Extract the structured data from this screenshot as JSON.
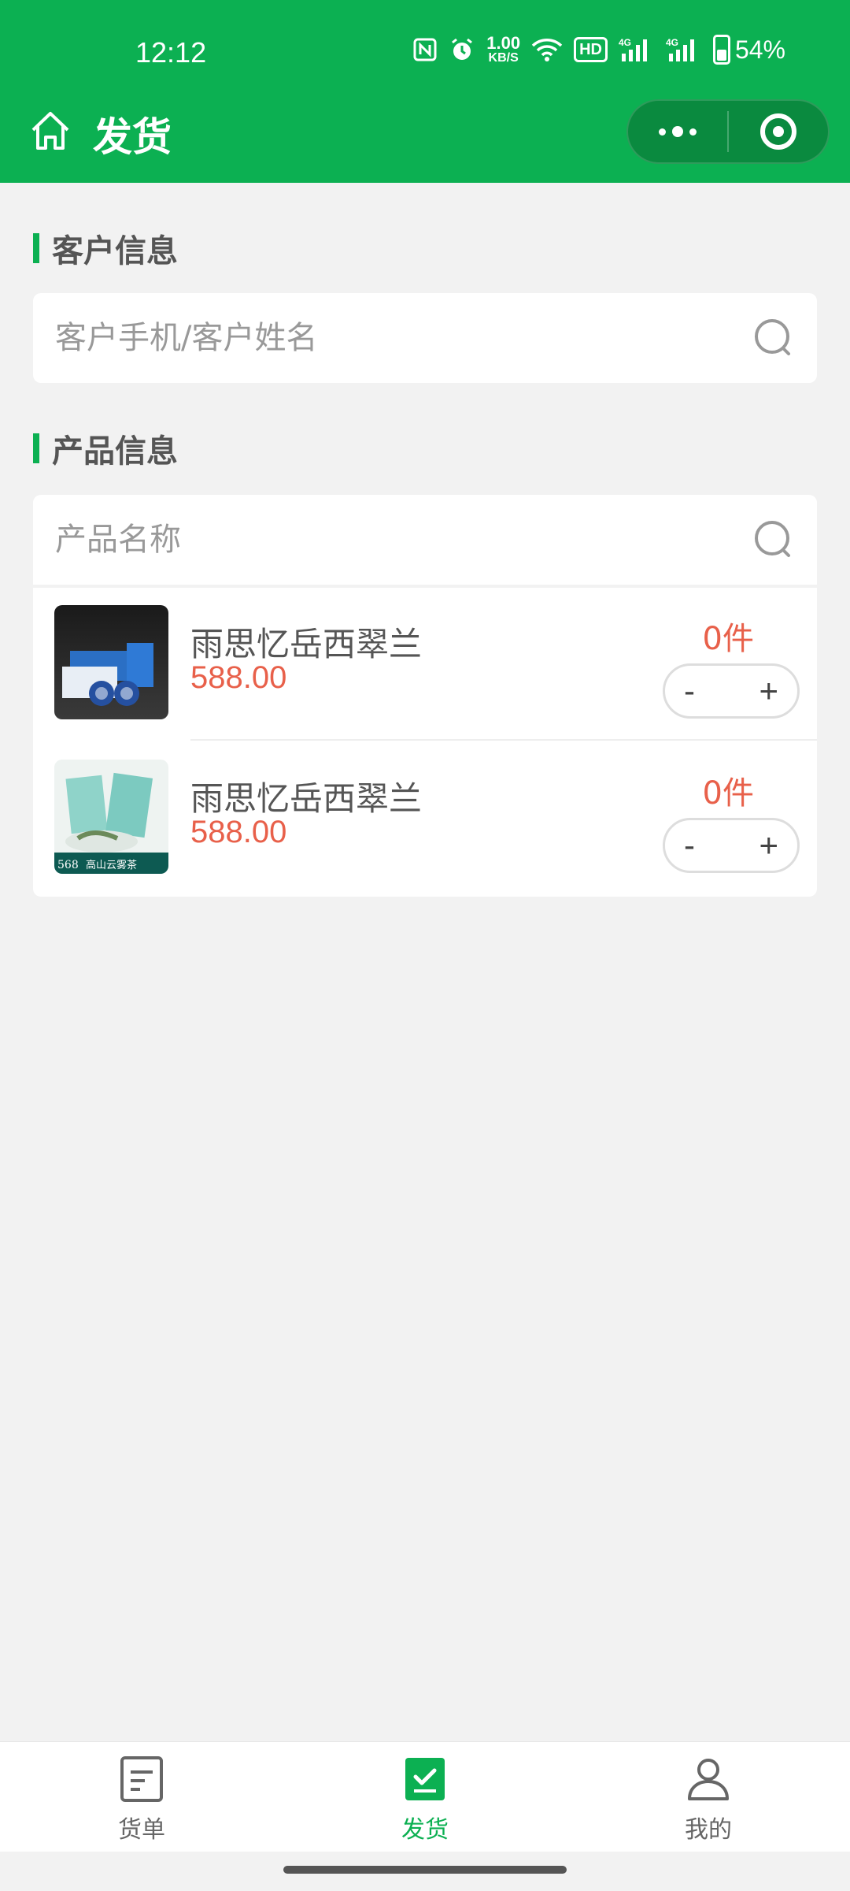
{
  "status_bar": {
    "time": "12:12",
    "net_speed_value": "1.00",
    "net_speed_unit": "KB/S",
    "hd_badge": "HD",
    "signal_1": "4G",
    "signal_2": "4G",
    "battery": "54%"
  },
  "nav": {
    "title": "发货",
    "home_icon": "home-icon",
    "more_icon": "more-dots-icon",
    "close_icon": "target-icon"
  },
  "customer_section": {
    "title": "客户信息",
    "search_placeholder": "客户手机/客户姓名"
  },
  "product_section": {
    "title": "产品信息",
    "search_placeholder": "产品名称"
  },
  "products": [
    {
      "name": "雨思忆岳西翠兰",
      "price": "588.00",
      "qty": "0件",
      "minus": "-",
      "plus": "+"
    },
    {
      "name": "雨思忆岳西翠兰",
      "price": "588.00",
      "qty": "0件",
      "minus": "-",
      "plus": "+",
      "thumb_text": "568",
      "thumb_caption": "高山云雾茶"
    }
  ],
  "tabbar": {
    "items": [
      {
        "label": "货单",
        "icon": "document-icon"
      },
      {
        "label": "发货",
        "icon": "checklist-icon"
      },
      {
        "label": "我的",
        "icon": "user-icon"
      }
    ],
    "active_index": 1
  },
  "colors": {
    "brand_green": "#0cb052",
    "price_red": "#e8604a"
  }
}
